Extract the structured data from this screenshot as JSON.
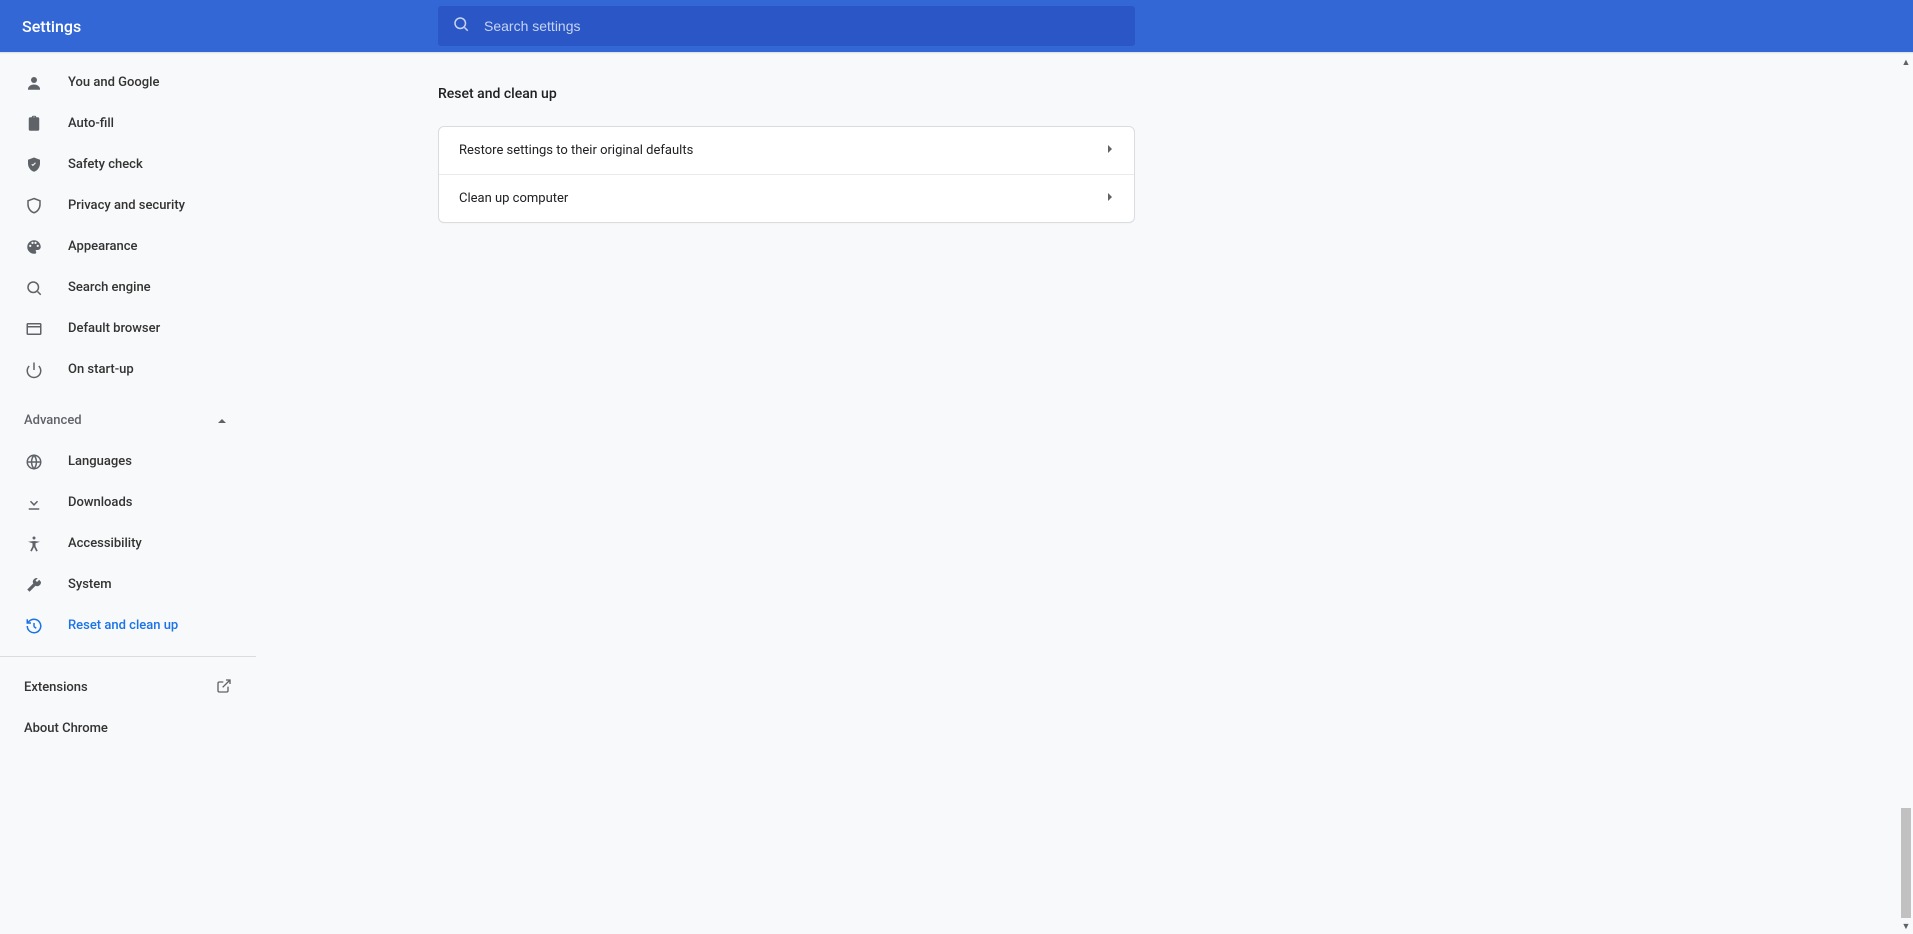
{
  "header": {
    "title": "Settings",
    "search_placeholder": "Search settings"
  },
  "sidebar": {
    "basic": [
      {
        "id": "you-and-google",
        "label": "You and Google"
      },
      {
        "id": "auto-fill",
        "label": "Auto-fill"
      },
      {
        "id": "safety-check",
        "label": "Safety check"
      },
      {
        "id": "privacy-and-security",
        "label": "Privacy and security"
      },
      {
        "id": "appearance",
        "label": "Appearance"
      },
      {
        "id": "search-engine",
        "label": "Search engine"
      },
      {
        "id": "default-browser",
        "label": "Default browser"
      },
      {
        "id": "on-start-up",
        "label": "On start-up"
      }
    ],
    "advanced_label": "Advanced",
    "advanced": [
      {
        "id": "languages",
        "label": "Languages"
      },
      {
        "id": "downloads",
        "label": "Downloads"
      },
      {
        "id": "accessibility",
        "label": "Accessibility"
      },
      {
        "id": "system",
        "label": "System"
      },
      {
        "id": "reset-and-clean-up",
        "label": "Reset and clean up",
        "active": true
      }
    ],
    "footer": [
      {
        "id": "extensions",
        "label": "Extensions",
        "external": true
      },
      {
        "id": "about-chrome",
        "label": "About Chrome"
      }
    ]
  },
  "main": {
    "title": "Reset and clean up",
    "rows": [
      {
        "id": "restore-defaults",
        "label": "Restore settings to their original defaults"
      },
      {
        "id": "clean-up-computer",
        "label": "Clean up computer"
      }
    ]
  }
}
